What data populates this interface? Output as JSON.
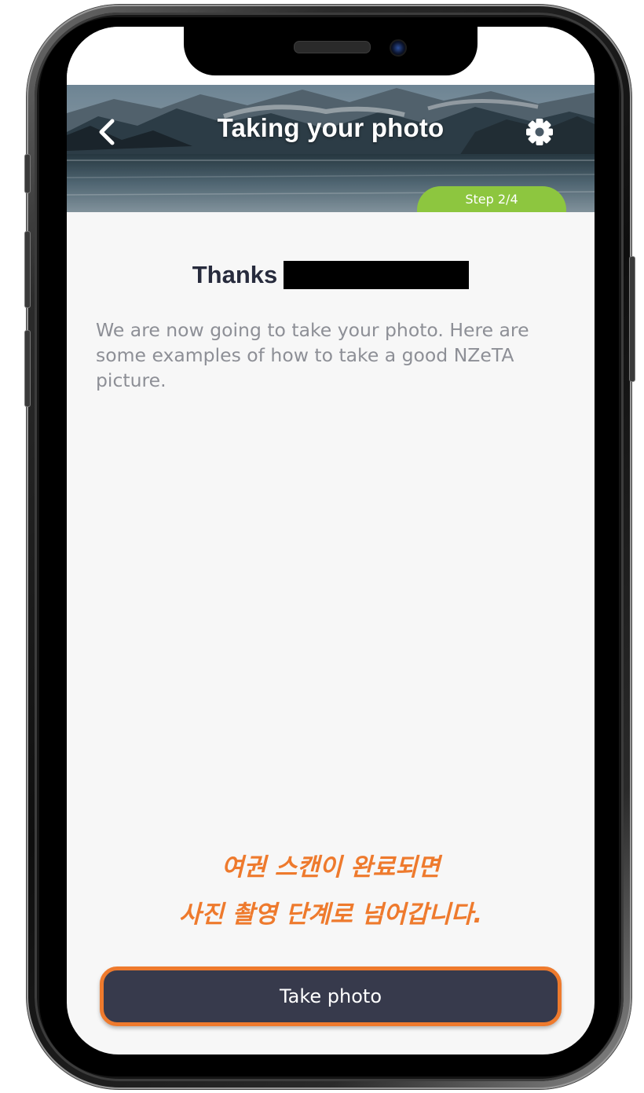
{
  "header": {
    "title": "Taking your photo",
    "step_label": "Step 2/4",
    "back_icon": "chevron-left-icon",
    "settings_icon": "gear-icon"
  },
  "content": {
    "thanks_label": "Thanks",
    "intro": "We are now going to take your photo. Here are some examples of how to take a good NZeTA picture."
  },
  "annotation": {
    "line1": "여권 스캔이 완료되면",
    "line2": "사진 촬영 단계로 넘어갑니다."
  },
  "actions": {
    "take_photo_label": "Take photo"
  },
  "colors": {
    "step_badge": "#8dc63f",
    "button_bg": "#373a4c",
    "highlight_orange": "#ee7a2d",
    "heading_text": "#272b3d",
    "body_text": "#8d8f96",
    "screen_bg": "#f7f7f7"
  }
}
